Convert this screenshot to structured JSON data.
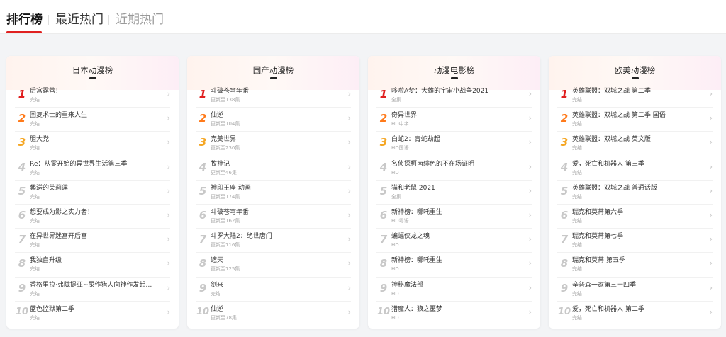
{
  "colors": {
    "accent": "#e02020",
    "rank_1": "#e02020",
    "rank_2": "#ff7a1a",
    "rank_3": "#f5a623",
    "rank_other": "#c8c8c8"
  },
  "tabs": [
    {
      "label": "排行榜",
      "active": true
    },
    {
      "label": "最近热门",
      "active": false
    },
    {
      "label": "近期热门",
      "active": false
    }
  ],
  "icons": {
    "row_chevron": "chevron-right-icon"
  },
  "cards": [
    {
      "title": "日本动漫榜",
      "items": [
        {
          "rank": "1",
          "name": "后宫露营！",
          "sub": "完结"
        },
        {
          "rank": "2",
          "name": "回复术士的重来人生",
          "sub": "完结"
        },
        {
          "rank": "3",
          "name": "胆大党",
          "sub": "完结"
        },
        {
          "rank": "4",
          "name": "Re：从零开始的异世界生活第三季",
          "sub": "完结"
        },
        {
          "rank": "5",
          "name": "葬送的芙莉莲",
          "sub": "完结"
        },
        {
          "rank": "6",
          "name": "想要成为影之实力者！",
          "sub": "完结"
        },
        {
          "rank": "7",
          "name": "在异世界迷宫开后宫",
          "sub": "完结"
        },
        {
          "rank": "8",
          "name": "我独自升级",
          "sub": "完结"
        },
        {
          "rank": "9",
          "name": "香格里拉·弗陇提亚~屎作猎人向神作发起挑战...",
          "sub": "完结"
        },
        {
          "rank": "10",
          "name": "蓝色监狱第二季",
          "sub": "完结"
        }
      ]
    },
    {
      "title": "国产动漫榜",
      "items": [
        {
          "rank": "1",
          "name": "斗破苍穹年番",
          "sub": "更新至138集"
        },
        {
          "rank": "2",
          "name": "仙逆",
          "sub": "更新至104集"
        },
        {
          "rank": "3",
          "name": "完美世界",
          "sub": "更新至230集"
        },
        {
          "rank": "4",
          "name": "牧神记",
          "sub": "更新至46集"
        },
        {
          "rank": "5",
          "name": "神印王座 动画",
          "sub": "更新至174集"
        },
        {
          "rank": "6",
          "name": "斗破苍穹年番",
          "sub": "更新至162集"
        },
        {
          "rank": "7",
          "name": "斗罗大陆2：绝世唐门",
          "sub": "更新至116集"
        },
        {
          "rank": "8",
          "name": "遮天",
          "sub": "更新至125集"
        },
        {
          "rank": "9",
          "name": "剑来",
          "sub": "完结"
        },
        {
          "rank": "10",
          "name": "仙逆",
          "sub": "更新至78集"
        }
      ]
    },
    {
      "title": "动漫电影榜",
      "items": [
        {
          "rank": "1",
          "name": "哆啦A梦：大雄的宇宙小战争2021",
          "sub": "全集"
        },
        {
          "rank": "2",
          "name": "奇异世界",
          "sub": "HD中字"
        },
        {
          "rank": "3",
          "name": "白蛇2：青蛇劫起",
          "sub": "HD国语"
        },
        {
          "rank": "4",
          "name": "名侦探柯南绯色的不在场证明",
          "sub": "HD"
        },
        {
          "rank": "5",
          "name": "猫和老鼠 2021",
          "sub": "全集"
        },
        {
          "rank": "6",
          "name": "新神榜：哪吒重生",
          "sub": "HD粤语"
        },
        {
          "rank": "7",
          "name": "蝙蝠侠龙之魂",
          "sub": "HD"
        },
        {
          "rank": "8",
          "name": "新神榜：哪吒重生",
          "sub": "HD"
        },
        {
          "rank": "9",
          "name": "神秘魔法部",
          "sub": "HD"
        },
        {
          "rank": "10",
          "name": "猎魔人：狼之噩梦",
          "sub": "HD"
        }
      ]
    },
    {
      "title": "欧美动漫榜",
      "items": [
        {
          "rank": "1",
          "name": "英雄联盟：双城之战 第二季",
          "sub": "完结"
        },
        {
          "rank": "2",
          "name": "英雄联盟：双城之战 第二季 国语",
          "sub": "完结"
        },
        {
          "rank": "3",
          "name": "英雄联盟：双城之战 英文版",
          "sub": "完结"
        },
        {
          "rank": "4",
          "name": "爱，死亡和机器人 第三季",
          "sub": "完结"
        },
        {
          "rank": "5",
          "name": "英雄联盟：双城之战 普通话版",
          "sub": "完结"
        },
        {
          "rank": "6",
          "name": "瑞克和莫蒂第六季",
          "sub": "完结"
        },
        {
          "rank": "7",
          "name": "瑞克和莫蒂第七季",
          "sub": "完结"
        },
        {
          "rank": "8",
          "name": "瑞克和莫蒂 第五季",
          "sub": "完结"
        },
        {
          "rank": "9",
          "name": "辛普森一家第三十四季",
          "sub": "完结"
        },
        {
          "rank": "10",
          "name": "爱，死亡和机器人 第二季",
          "sub": "完结"
        }
      ]
    }
  ]
}
